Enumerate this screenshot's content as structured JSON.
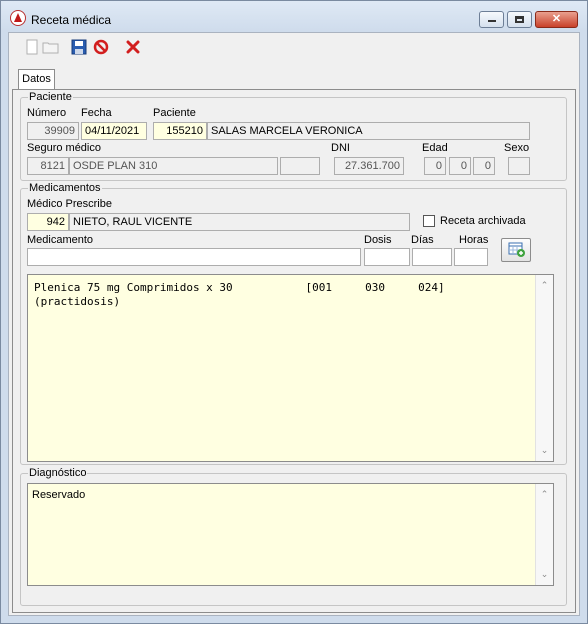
{
  "window": {
    "title": "Receta médica"
  },
  "toolbar": {
    "new_icon": "new-document-icon",
    "open_icon": "open-folder-icon",
    "save_icon": "save-disk-icon",
    "cancel_icon": "cancel-prohibited-icon",
    "delete_icon": "delete-x-icon"
  },
  "tabs": [
    {
      "label": "Datos"
    }
  ],
  "paciente": {
    "legend": "Paciente",
    "numero_label": "Número",
    "numero": "39909",
    "fecha_label": "Fecha",
    "fecha": "04/11/2021",
    "paciente_label": "Paciente",
    "paciente_id": "155210",
    "paciente_nombre": "SALAS MARCELA VERONICA",
    "seguro_label": "Seguro médico",
    "seguro_codigo": "8121",
    "seguro_nombre": "OSDE  PLAN 310",
    "seguro_extra": "",
    "dni_label": "DNI",
    "dni": "27.361.700",
    "edad_label": "Edad",
    "edad": [
      "0",
      "0",
      "0"
    ],
    "sexo_label": "Sexo",
    "sexo": ""
  },
  "medicamentos": {
    "legend": "Medicamentos",
    "medico_label": "Médico Prescribe",
    "medico_id": "942",
    "medico_nombre": "NIETO, RAUL VICENTE",
    "archivada_label": "Receta archivada",
    "archivada_checked": false,
    "medicamento_label": "Medicamento",
    "medicamento": "",
    "dosis_label": "Dosis",
    "dosis": "",
    "dias_label": "Días",
    "dias": "",
    "horas_label": "Horas",
    "horas": "",
    "add_icon": "table-add-icon",
    "lista": "Plenica 75 mg Comprimidos x 30           [001     030     024]\n(practidosis)"
  },
  "diagnostico": {
    "legend": "Diagnóstico",
    "texto": "Reservado"
  },
  "colors": {
    "memo_background": "#ffffe1",
    "title_bar": "#dfe9f5",
    "close_button": "#c9412a"
  }
}
